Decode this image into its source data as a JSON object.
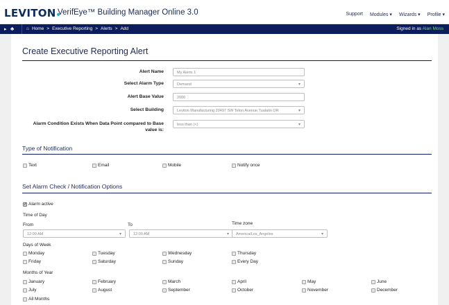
{
  "header": {
    "logo_text": "LEVITON",
    "app_title": "VerifEye™ Building Manager Online 3.0",
    "nav": [
      "Support",
      "Modules",
      "Wizards",
      "Profile"
    ]
  },
  "navbar": {
    "crumbs": [
      "Home",
      ">",
      "Executive Reporting",
      ">",
      "Alerts",
      ">",
      "Add"
    ],
    "signed_prefix": "Signed in as",
    "user": "Alan Moss"
  },
  "form": {
    "title": "Create Executive Reporting Alert",
    "fields": [
      {
        "label": "Alert Name",
        "value": "My Alerts 1"
      },
      {
        "label": "Select Alarm Type",
        "value": "Demand"
      },
      {
        "label": "Alert Base Value",
        "value": "2000"
      },
      {
        "label": "Select Building",
        "value": "Leviton Manufacturing 20497 SW Teton Avenue,Tualatin OR"
      },
      {
        "label": "Alarm Condition Exists When Data Point compared to Base value is:",
        "value": "less than (<)"
      }
    ]
  },
  "notification": {
    "title": "Type of Notification",
    "options": [
      "Text",
      "Email",
      "Mobile",
      "Notify once"
    ]
  },
  "alarm": {
    "title": "Set Alarm Check / Notification Options",
    "active_label": "Alarm active",
    "time_of_day": "Time of Day",
    "from_label": "From",
    "to_label": "To",
    "timezone_label": "Time zone",
    "from_value": "12:00 AM",
    "to_value": "12:00 AM",
    "timezone_value": "America/Los_Angeles",
    "days_label": "Days of Week",
    "days": [
      "Monday",
      "Tuesday",
      "Wednesday",
      "Thursday",
      "Friday",
      "Saturday",
      "Sunday",
      "Every Day"
    ],
    "months_label": "Months of Year",
    "months": [
      "January",
      "February",
      "March",
      "April",
      "May",
      "June",
      "July",
      "August",
      "September",
      "October",
      "November",
      "December",
      "All Months"
    ]
  },
  "colors": {
    "navy": "#0b1d5c",
    "accent": "#27a9e1",
    "user_green": "#7fd67a"
  }
}
